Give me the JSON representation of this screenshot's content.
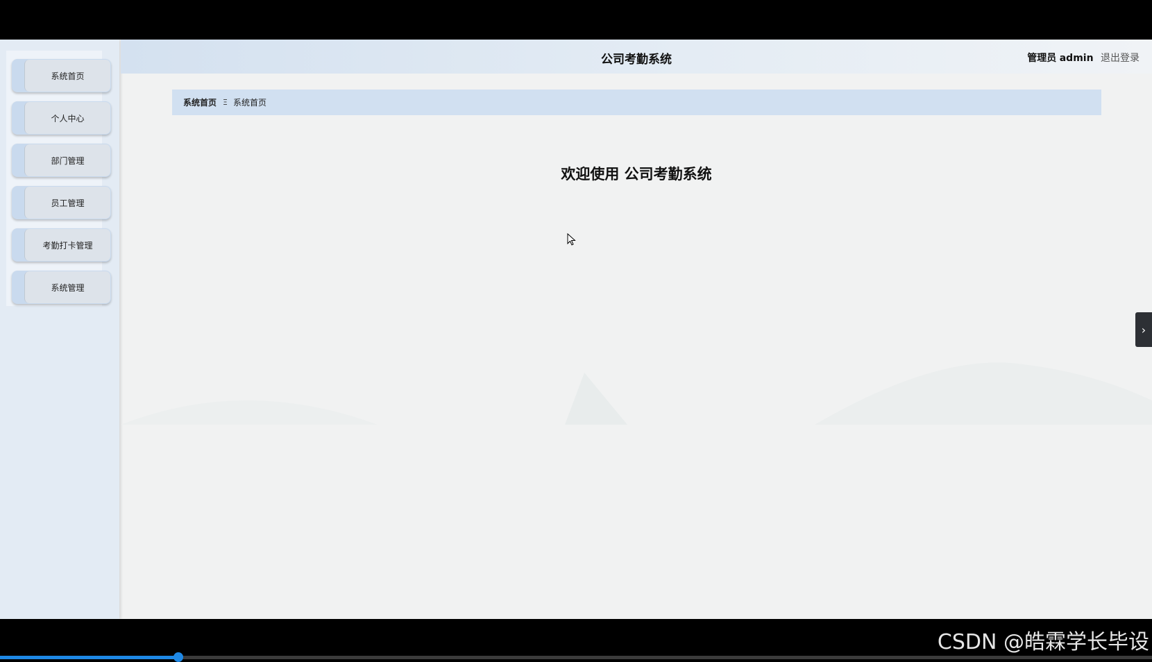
{
  "app": {
    "title": "公司考勤系统",
    "welcome_prefix": "欢迎使用",
    "user_role": "管理员",
    "user_name": "admin",
    "logout_label": "退出登录"
  },
  "sidebar": {
    "items": [
      {
        "label": "系统首页"
      },
      {
        "label": "个人中心"
      },
      {
        "label": "部门管理"
      },
      {
        "label": "员工管理"
      },
      {
        "label": "考勤打卡管理"
      },
      {
        "label": "系统管理"
      }
    ]
  },
  "breadcrumb": {
    "root": "系统首页",
    "separator": "Ξ",
    "current": "系统首页"
  },
  "side_toggle": {
    "glyph": "›"
  },
  "video": {
    "watermark": "CSDN @皓霖学长毕设",
    "progress": 0.155
  },
  "colors": {
    "header_start": "#d4e1f0",
    "breadcrumb_bg": "#d1e0f1",
    "menu_accent": "#c9daee",
    "progress": "#1e88e5"
  }
}
